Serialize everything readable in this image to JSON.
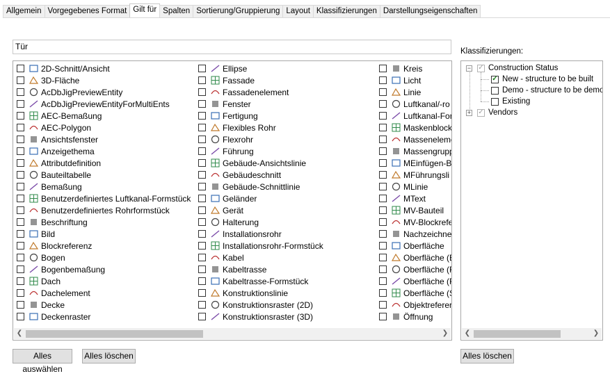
{
  "tabs": [
    {
      "label": "Allgemein",
      "active": false
    },
    {
      "label": "Vorgegebenes Format",
      "active": false
    },
    {
      "label": "Gilt für",
      "active": true
    },
    {
      "label": "Spalten",
      "active": false
    },
    {
      "label": "Sortierung/Gruppierung",
      "active": false
    },
    {
      "label": "Layout",
      "active": false
    },
    {
      "label": "Klassifizierungen",
      "active": false
    },
    {
      "label": "Darstellungseigenschaften",
      "active": false
    }
  ],
  "filter": {
    "value": "Tür"
  },
  "columns": [
    [
      {
        "label": "2D-Schnitt/Ansicht",
        "icon": "section-view-icon"
      },
      {
        "label": "3D-Fläche",
        "icon": "3d-face-icon"
      },
      {
        "label": "AcDbJigPreviewEntity",
        "icon": "brush-icon"
      },
      {
        "label": "AcDbJigPreviewEntityForMultiEnts",
        "icon": "brush-icon"
      },
      {
        "label": "AEC-Bemaßung",
        "icon": "aec-dimension-icon"
      },
      {
        "label": "AEC-Polygon",
        "icon": "polygon-icon"
      },
      {
        "label": "Ansichtsfenster",
        "icon": "viewport-icon"
      },
      {
        "label": "Anzeigethema",
        "icon": "display-theme-icon"
      },
      {
        "label": "Attributdefinition",
        "icon": "attribute-icon"
      },
      {
        "label": "Bauteiltabelle",
        "icon": "table-icon"
      },
      {
        "label": "Bemaßung",
        "icon": "dimension-icon"
      },
      {
        "label": "Benutzerdefiniertes Luftkanal-Formstück",
        "icon": "duct-fitting-icon"
      },
      {
        "label": "Benutzerdefiniertes Rohrformstück",
        "icon": "pipe-fitting-icon"
      },
      {
        "label": "Beschriftung",
        "icon": "label-icon"
      },
      {
        "label": "Bild",
        "icon": "image-icon"
      },
      {
        "label": "Blockreferenz",
        "icon": "block-icon"
      },
      {
        "label": "Bogen",
        "icon": "arc-icon"
      },
      {
        "label": "Bogenbemaßung",
        "icon": "arc-dimension-icon"
      },
      {
        "label": "Dach",
        "icon": "roof-icon"
      },
      {
        "label": "Dachelement",
        "icon": "roof-slab-icon"
      },
      {
        "label": "Decke",
        "icon": "slab-icon"
      },
      {
        "label": "Deckenraster",
        "icon": "ceiling-grid-icon"
      }
    ],
    [
      {
        "label": "Ellipse",
        "icon": "ellipse-icon"
      },
      {
        "label": "Fassade",
        "icon": "facade-icon"
      },
      {
        "label": "Fassadenelement",
        "icon": "facade-element-icon"
      },
      {
        "label": "Fenster",
        "icon": "window-icon"
      },
      {
        "label": "Fertigung",
        "icon": "fabrication-icon"
      },
      {
        "label": "Flexibles Rohr",
        "icon": "flex-pipe-icon"
      },
      {
        "label": "Flexrohr",
        "icon": "flex-duct-icon"
      },
      {
        "label": "Führung",
        "icon": "leader-icon"
      },
      {
        "label": "Gebäude-Ansichtslinie",
        "icon": "elevation-line-icon"
      },
      {
        "label": "Gebäudeschnitt",
        "icon": "building-section-icon"
      },
      {
        "label": "Gebäude-Schnittlinie",
        "icon": "section-line-icon"
      },
      {
        "label": "Geländer",
        "icon": "railing-icon"
      },
      {
        "label": "Gerät",
        "icon": "device-icon"
      },
      {
        "label": "Halterung",
        "icon": "hanger-icon"
      },
      {
        "label": "Installationsrohr",
        "icon": "conduit-icon"
      },
      {
        "label": "Installationsrohr-Formstück",
        "icon": "conduit-fitting-icon"
      },
      {
        "label": "Kabel",
        "icon": "wire-icon"
      },
      {
        "label": "Kabeltrasse",
        "icon": "cable-tray-icon"
      },
      {
        "label": "Kabeltrasse-Formstück",
        "icon": "cable-tray-fitting-icon"
      },
      {
        "label": "Konstruktionslinie",
        "icon": "construction-line-icon"
      },
      {
        "label": "Konstruktionsraster (2D)",
        "icon": "grid-2d-icon"
      },
      {
        "label": "Konstruktionsraster (3D)",
        "icon": "grid-3d-icon"
      }
    ],
    [
      {
        "label": "Kreis",
        "icon": "circle-icon"
      },
      {
        "label": "Licht",
        "icon": "light-icon"
      },
      {
        "label": "Linie",
        "icon": "line-icon"
      },
      {
        "label": "Luftkanal/-ro",
        "icon": "duct-icon"
      },
      {
        "label": "Luftkanal-For",
        "icon": "duct-fitting2-icon"
      },
      {
        "label": "Maskenblock",
        "icon": "mask-block-icon"
      },
      {
        "label": "Masseneleme",
        "icon": "mass-element-icon"
      },
      {
        "label": "Massengrupp",
        "icon": "mass-group-icon"
      },
      {
        "label": "MEinfügen-B",
        "icon": "minsert-icon"
      },
      {
        "label": "MFührungsli",
        "icon": "mleader-icon"
      },
      {
        "label": "MLinie",
        "icon": "mline-icon"
      },
      {
        "label": "MText",
        "icon": "mtext-icon"
      },
      {
        "label": "MV-Bauteil",
        "icon": "mv-part-icon"
      },
      {
        "label": "MV-Blockrefe",
        "icon": "mv-block-icon"
      },
      {
        "label": "Nachzeichne",
        "icon": "trace-icon"
      },
      {
        "label": "Oberfläche",
        "icon": "surface-icon"
      },
      {
        "label": "Oberfläche (E",
        "icon": "surface-e-icon"
      },
      {
        "label": "Oberfläche (F",
        "icon": "surface-f-icon"
      },
      {
        "label": "Oberfläche (F",
        "icon": "surface-f2-icon"
      },
      {
        "label": "Oberfläche (S",
        "icon": "surface-s-icon"
      },
      {
        "label": "Objektreferer",
        "icon": "object-ref-icon"
      },
      {
        "label": "Öffnung",
        "icon": "opening-icon"
      }
    ]
  ],
  "classifications_label": "Klassifizierungen:",
  "tree": [
    {
      "label": "Construction Status",
      "level": 0,
      "expander": "−",
      "checked": "grey"
    },
    {
      "label": "New - structure to be built",
      "level": 1,
      "expander": "",
      "checked": "yes"
    },
    {
      "label": "Demo - structure to be demolis",
      "level": 1,
      "expander": "",
      "checked": "no"
    },
    {
      "label": "Existing",
      "level": 1,
      "expander": "",
      "checked": "no"
    },
    {
      "label": "Vendors",
      "level": 0,
      "expander": "+",
      "checked": "grey"
    }
  ],
  "buttons": {
    "select_all": "Alles auswählen",
    "clear_all": "Alles löschen",
    "clear_all_right": "Alles löschen"
  }
}
